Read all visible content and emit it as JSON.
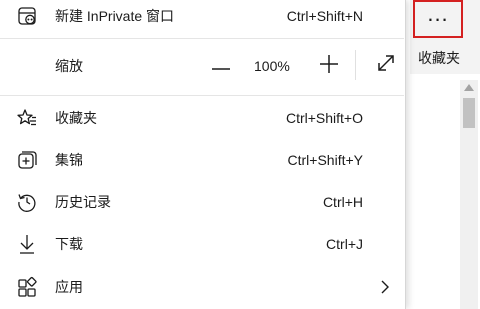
{
  "menu": {
    "inprivate": {
      "label": "新建 InPrivate 窗口",
      "shortcut": "Ctrl+Shift+N",
      "icon": "inprivate-window-icon"
    },
    "zoom": {
      "label": "缩放",
      "value": "100%",
      "minus_icon": "minus-icon",
      "plus_icon": "plus-icon",
      "fullscreen_icon": "fullscreen-icon"
    },
    "items": [
      {
        "label": "收藏夹",
        "shortcut": "Ctrl+Shift+O",
        "icon": "favorites-star-icon"
      },
      {
        "label": "集锦",
        "shortcut": "Ctrl+Shift+Y",
        "icon": "collections-icon"
      },
      {
        "label": "历史记录",
        "shortcut": "Ctrl+H",
        "icon": "history-icon"
      },
      {
        "label": "下载",
        "shortcut": "Ctrl+J",
        "icon": "download-icon"
      },
      {
        "label": "应用",
        "shortcut": "",
        "icon": "apps-icon",
        "submenu": true
      }
    ]
  },
  "toolbar": {
    "more_label": "...",
    "favorites_label": "收藏夹"
  },
  "colors": {
    "highlight_border": "#d42020",
    "menu_bg": "#ffffff",
    "chrome_bg": "#f3f3f3"
  }
}
